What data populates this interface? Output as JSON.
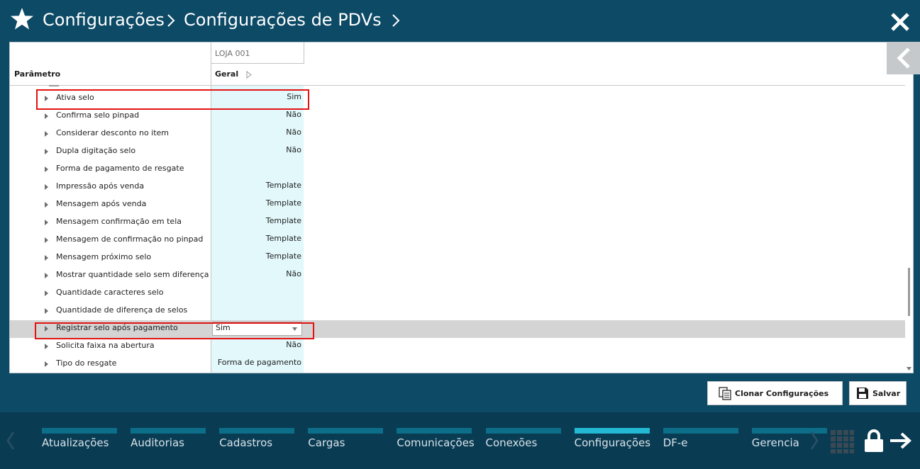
{
  "header": {
    "breadcrumb_1": "Configurações",
    "breadcrumb_2": "Configurações de PDVs"
  },
  "table": {
    "store_column": "LOJA 001",
    "param_header": "Parâmetro",
    "group_header": "Geral",
    "rows": [
      {
        "label": "Ativa selo",
        "value": "Sim"
      },
      {
        "label": "Confirma selo pinpad",
        "value": "Não"
      },
      {
        "label": "Considerar desconto no item",
        "value": "Não"
      },
      {
        "label": "Dupla digitação selo",
        "value": "Não"
      },
      {
        "label": "Forma de pagamento de resgate",
        "value": ""
      },
      {
        "label": "Impressão após venda",
        "value": "Template"
      },
      {
        "label": "Mensagem após venda",
        "value": "Template"
      },
      {
        "label": "Mensagem confirmação em tela",
        "value": "Template"
      },
      {
        "label": "Mensagem de confirmação no pinpad",
        "value": "Template"
      },
      {
        "label": "Mensagem próximo selo",
        "value": "Template"
      },
      {
        "label": "Mostrar quantidade selo sem diferença",
        "value": "Não"
      },
      {
        "label": "Quantidade caracteres selo",
        "value": ""
      },
      {
        "label": "Quantidade de diferença de selos",
        "value": ""
      },
      {
        "label": "Registrar selo após pagamento",
        "value": "Sim",
        "editing": true
      },
      {
        "label": "Solicita faixa na abertura",
        "value": "Não"
      },
      {
        "label": "Tipo do resgate",
        "value": "Forma de pagamento"
      }
    ]
  },
  "actions": {
    "clone_label": "Clonar Configurações",
    "save_label": "Salvar"
  },
  "bottom_nav": {
    "tabs": [
      {
        "label": "Atualizações"
      },
      {
        "label": "Auditorias"
      },
      {
        "label": "Cadastros"
      },
      {
        "label": "Cargas"
      },
      {
        "label": "Comunicações"
      },
      {
        "label": "Conexões"
      },
      {
        "label": "Configurações",
        "active": true
      },
      {
        "label": "DF-e"
      },
      {
        "label": "Gerencia"
      }
    ]
  },
  "colors": {
    "header_bg": "#0d4a66",
    "bottom_bg": "#093b53",
    "value_column_bg": "#e2f8fb",
    "selected_row_bg": "#d4d4d4",
    "highlight": "#e31313",
    "active_tab": "#23b8d4",
    "tab_bar": "#0c6e88"
  },
  "icons": [
    "star-icon",
    "chevron-right-icon",
    "close-icon",
    "chevron-left-icon",
    "caret-right-icon",
    "dropdown-caret-icon",
    "clone-icon",
    "save-icon",
    "grid-icon",
    "lock-icon",
    "logout-arrow-icon"
  ]
}
